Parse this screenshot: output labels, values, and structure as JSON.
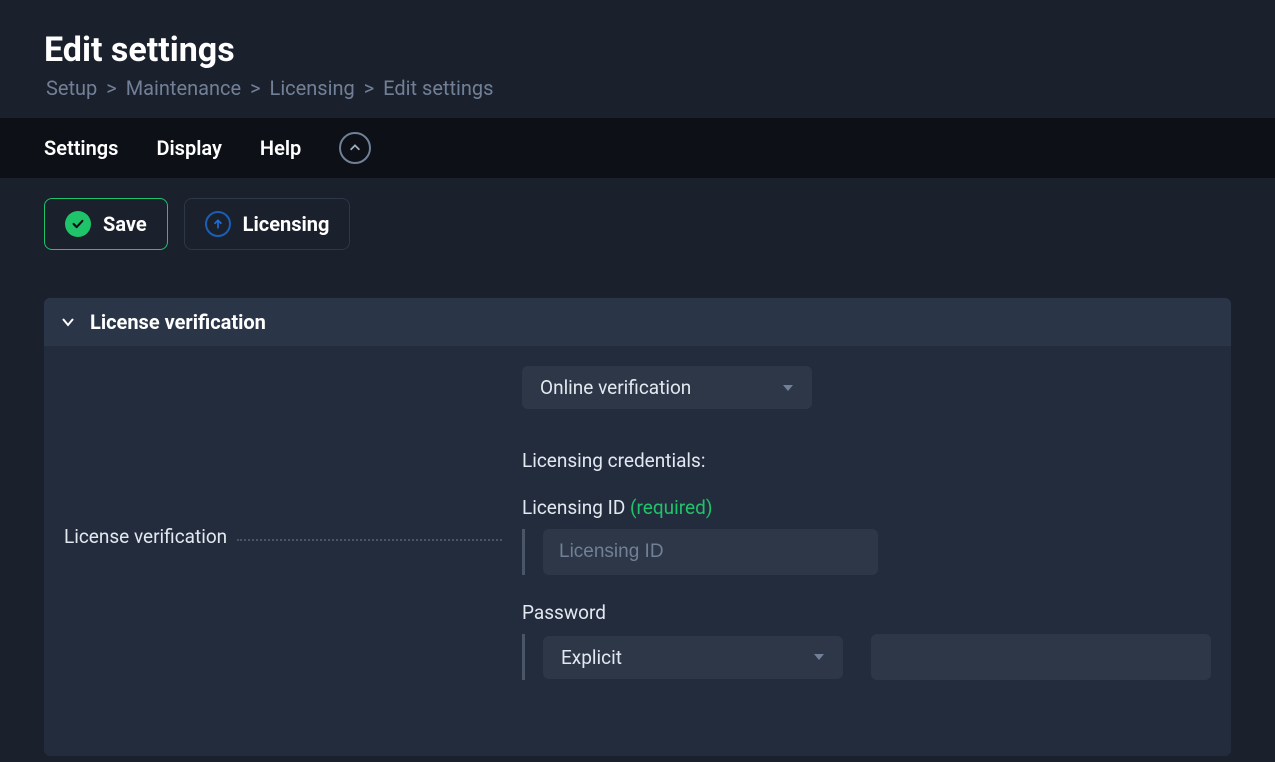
{
  "header": {
    "title": "Edit settings",
    "breadcrumb": {
      "items": [
        "Setup",
        "Maintenance",
        "Licensing",
        "Edit settings"
      ],
      "separator": ">"
    }
  },
  "menubar": {
    "items": [
      "Settings",
      "Display",
      "Help"
    ]
  },
  "actions": {
    "save_label": "Save",
    "licensing_label": "Licensing"
  },
  "section": {
    "title": "License verification",
    "fields": {
      "verification": {
        "label": "License verification",
        "value": "Online verification"
      },
      "credentials_header": "Licensing credentials:",
      "licensing_id": {
        "label": "Licensing ID",
        "required_label": "(required)",
        "placeholder": "Licensing ID",
        "value": ""
      },
      "password": {
        "label": "Password",
        "mode_value": "Explicit",
        "value": ""
      }
    }
  }
}
